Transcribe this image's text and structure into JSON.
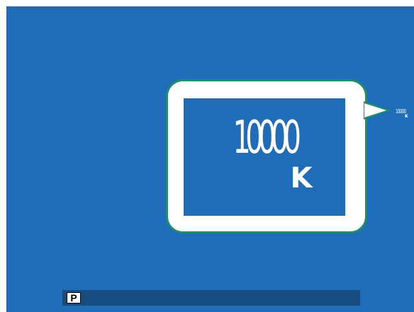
{
  "white_balance": {
    "value": "10000",
    "unit": "K"
  },
  "status_bar": {
    "mode": "P"
  },
  "colors": {
    "screen_background": "#1F6DB8",
    "callout_border": "#1F8F6B",
    "callout_fill": "#ffffff",
    "status_bar": "#164C80"
  }
}
